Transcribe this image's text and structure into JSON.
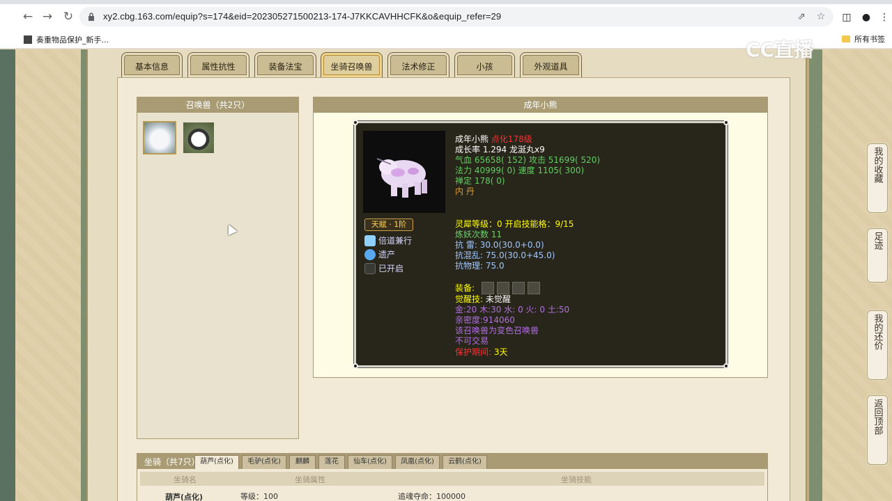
{
  "browser": {
    "url": "xy2.cbg.163.com/equip?s=174&eid=202305271500213-174-J7KKCAVHHCFK&o&equip_refer=29",
    "bookmark_left": "奏重物品保护_新手...",
    "bookmark_right": "所有书签",
    "icons": [
      "back-icon",
      "forward-icon",
      "reload-icon",
      "lock-icon",
      "share-icon",
      "star-icon",
      "sidepanel-icon",
      "profile-icon",
      "menu-icon"
    ]
  },
  "watermark": "CC直播",
  "tabs": [
    {
      "label": "基本信息",
      "active": false
    },
    {
      "label": "属性抗性",
      "active": false
    },
    {
      "label": "装备法宝",
      "active": false
    },
    {
      "label": "坐骑召唤兽",
      "active": true
    },
    {
      "label": "法术修正",
      "active": false
    },
    {
      "label": "小孩",
      "active": false
    },
    {
      "label": "外观道具",
      "active": false
    }
  ],
  "pet_list": {
    "title": "召唤兽（共2只）",
    "items": [
      "polar-bear-pet",
      "panda-pet"
    ]
  },
  "pet_detail": {
    "header": "成年小熊",
    "name": "成年小熊",
    "level": "点化178级",
    "growth": "成长率 1.294 龙涎丸x9",
    "hp_label": "气血",
    "hp_value": "65658( 152)",
    "atk_label": "攻击",
    "atk_value": "51699( 520)",
    "mp_label": "法力",
    "mp_value": "40999( 0)",
    "spd_label": "速度",
    "spd_value": "1105( 300)",
    "zen_label": "禅定",
    "zen_value": "178( 0)",
    "inner_dan": "内  丹",
    "talent": "天赋 · 1阶",
    "skills": [
      "倍道兼行",
      "遗产",
      "已开启"
    ],
    "spirit": "灵犀等级：0 开启技能格：9/15",
    "refine": "炼妖次数 11",
    "res1_label": "抗    雷:",
    "res1_value": "30.0(30.0+0.0)",
    "res2_label": "抗混乱:",
    "res2_value": "75.0(30.0+45.0)",
    "res3": "抗物理: 75.0",
    "equip_label": "装备:",
    "awaken_label": "觉醒技:",
    "awaken_value": "未觉醒",
    "elements": "金:20 木:30 水: 0 火: 0 土:50",
    "intimacy": "亲密度:914060",
    "variant": "该召唤兽为变色召唤兽",
    "no_trade": "不可交易",
    "protect_label": "保护期间:",
    "protect_value": "3天"
  },
  "mount": {
    "title": "坐骑（共7只）",
    "tabs": [
      "葫芦(点化)",
      "毛驴(点化)",
      "麒麟",
      "莲花",
      "仙车(点化)",
      "凤凰(点化)",
      "云鹤(点化)"
    ],
    "columns": [
      "坐骑名",
      "坐骑属性",
      "坐骑技能"
    ],
    "row": {
      "name": "葫芦(点化)",
      "attr": "等级：100",
      "skill": "追魂夺命：100000"
    }
  },
  "float_buttons": [
    "我的收藏",
    "足迹",
    "我的还价",
    "返回顶部"
  ]
}
